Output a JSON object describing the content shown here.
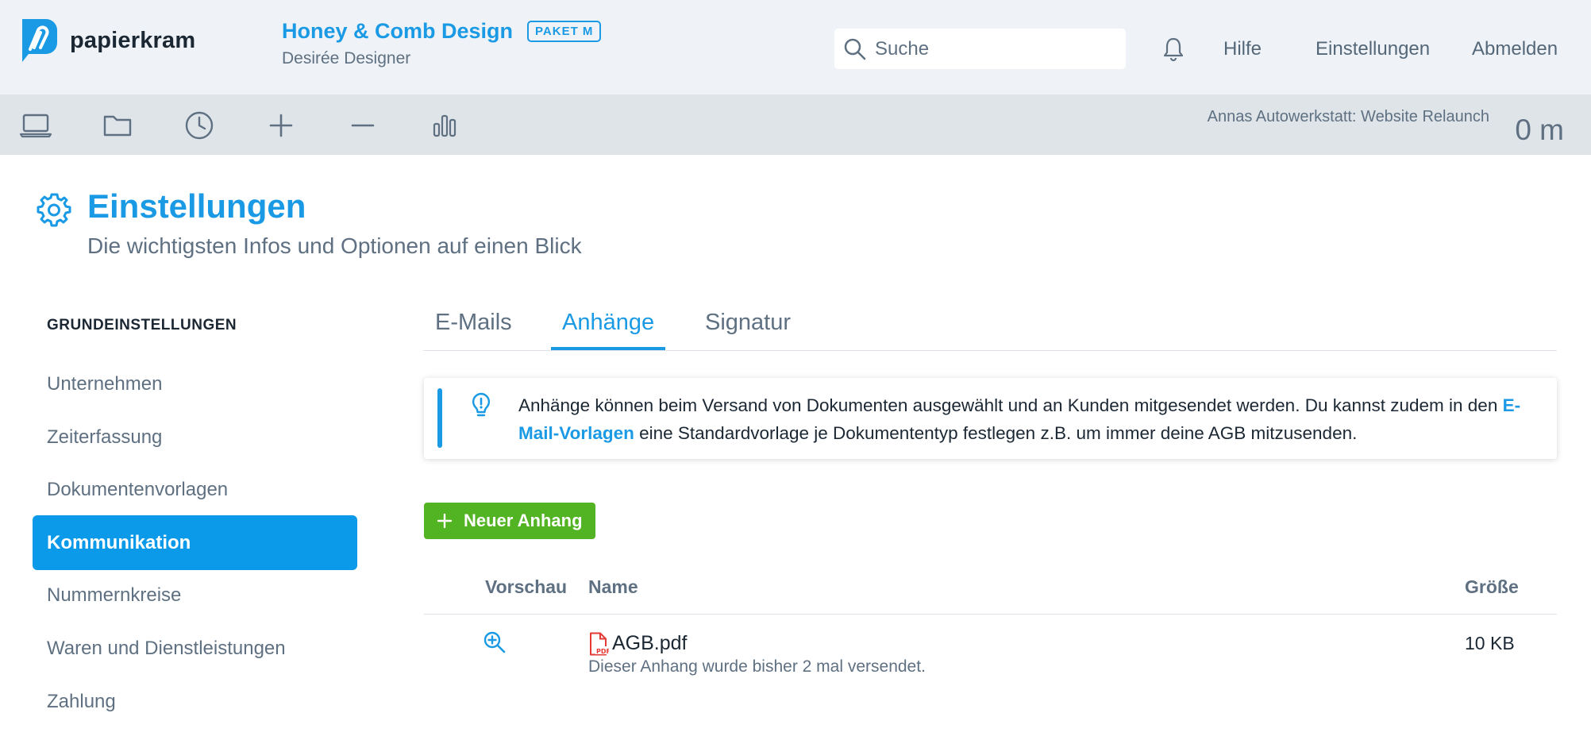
{
  "app": {
    "logo_text": "papierkram"
  },
  "header": {
    "company": "Honey & Comb Design",
    "plan": "PAKET M",
    "user": "Desirée Designer",
    "search_placeholder": "Suche",
    "links": {
      "help": "Hilfe",
      "settings": "Einstellungen",
      "logout": "Abmelden"
    }
  },
  "toolbar": {
    "icons": [
      "laptop-icon",
      "folder-icon",
      "clock-icon",
      "plus-icon",
      "minus-icon",
      "bar-chart-icon"
    ],
    "project": "Annas Autowerkstatt: Website Relaunch",
    "timer": "0 m"
  },
  "page": {
    "title": "Einstellungen",
    "subtitle": "Die wichtigsten Infos und Optionen auf einen Blick"
  },
  "sidebar": {
    "heading": "GRUNDEINSTELLUNGEN",
    "items": [
      {
        "label": "Unternehmen"
      },
      {
        "label": "Zeiterfassung"
      },
      {
        "label": "Dokumentenvorlagen"
      },
      {
        "label": "Kommunikation",
        "active": true
      },
      {
        "label": "Nummernkreise"
      },
      {
        "label": "Waren und Dienstleistungen"
      },
      {
        "label": "Zahlung"
      }
    ]
  },
  "tabs": [
    {
      "label": "E-Mails"
    },
    {
      "label": "Anhänge",
      "active": true
    },
    {
      "label": "Signatur"
    }
  ],
  "info": {
    "text_before": "Anhänge können beim Versand von Dokumenten ausgewählt und an Kunden mitgesendet werden. Du kannst zudem in den ",
    "link": "E-Mail-Vorlagen",
    "text_after": " eine Standardvorlage je Dokumententyp festlegen z.B. um immer deine AGB mitzusenden."
  },
  "new_button": {
    "label": "Neuer Anhang"
  },
  "table": {
    "columns": {
      "preview": "Vorschau",
      "name": "Name",
      "size": "Größe"
    },
    "rows": [
      {
        "name": "AGB.pdf",
        "note": "Dieser Anhang wurde bisher 2 mal versendet.",
        "size": "10 KB"
      }
    ]
  },
  "colors": {
    "accent": "#1a9ae4",
    "success": "#52b423",
    "header_bg": "#eff3f7",
    "toolbar_bg": "#dfe4e9",
    "pdf": "#e53935"
  }
}
